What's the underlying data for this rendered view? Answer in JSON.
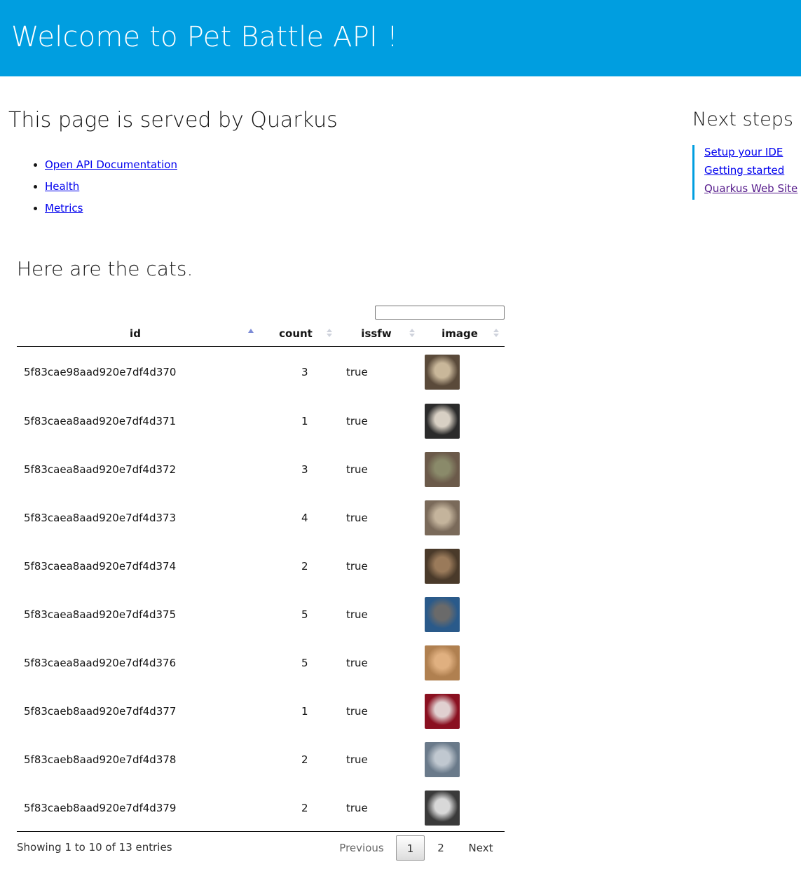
{
  "header": {
    "title": "Welcome to Pet Battle API !"
  },
  "main": {
    "heading": "This page is served by Quarkus",
    "links": [
      {
        "label": "Open API Documentation"
      },
      {
        "label": "Health"
      },
      {
        "label": "Metrics"
      }
    ]
  },
  "aside": {
    "title": "Next steps",
    "links": [
      {
        "label": "Setup your IDE"
      },
      {
        "label": "Getting started"
      },
      {
        "label": "Quarkus Web Site"
      }
    ]
  },
  "cats": {
    "heading": "Here are the cats.",
    "search": {
      "value": ""
    },
    "columns": [
      "id",
      "count",
      "issfw",
      "image"
    ],
    "rows": [
      {
        "id": "5f83cae98aad920e7df4d370",
        "count": "3",
        "issfw": "true",
        "thumb_colors": [
          "#5a4a3a",
          "#c9b79a"
        ]
      },
      {
        "id": "5f83caea8aad920e7df4d371",
        "count": "1",
        "issfw": "true",
        "thumb_colors": [
          "#2b2b2b",
          "#d8d0c4"
        ]
      },
      {
        "id": "5f83caea8aad920e7df4d372",
        "count": "3",
        "issfw": "true",
        "thumb_colors": [
          "#6b5a4a",
          "#8a8a6a"
        ]
      },
      {
        "id": "5f83caea8aad920e7df4d373",
        "count": "4",
        "issfw": "true",
        "thumb_colors": [
          "#7a6a5a",
          "#c4b49c"
        ]
      },
      {
        "id": "5f83caea8aad920e7df4d374",
        "count": "2",
        "issfw": "true",
        "thumb_colors": [
          "#4a3a2a",
          "#9a7a5a"
        ]
      },
      {
        "id": "5f83caea8aad920e7df4d375",
        "count": "5",
        "issfw": "true",
        "thumb_colors": [
          "#2a5a8a",
          "#6a6a6a"
        ]
      },
      {
        "id": "5f83caea8aad920e7df4d376",
        "count": "5",
        "issfw": "true",
        "thumb_colors": [
          "#b08050",
          "#e0b080"
        ]
      },
      {
        "id": "5f83caeb8aad920e7df4d377",
        "count": "1",
        "issfw": "true",
        "thumb_colors": [
          "#8a1020",
          "#e0d0d0"
        ]
      },
      {
        "id": "5f83caeb8aad920e7df4d378",
        "count": "2",
        "issfw": "true",
        "thumb_colors": [
          "#6a7a8a",
          "#c0c8d0"
        ]
      },
      {
        "id": "5f83caeb8aad920e7df4d379",
        "count": "2",
        "issfw": "true",
        "thumb_colors": [
          "#3a3a3a",
          "#d8d8d8"
        ]
      }
    ],
    "info": "Showing 1 to 10 of 13 entries",
    "pager": {
      "previous": "Previous",
      "pages": [
        "1",
        "2"
      ],
      "current": "1",
      "next": "Next"
    },
    "sorted_column": "id",
    "sort_direction": "ascending"
  },
  "colors": {
    "brand": "#009ee0",
    "link": "#0000ee",
    "visited": "#551a8b"
  }
}
